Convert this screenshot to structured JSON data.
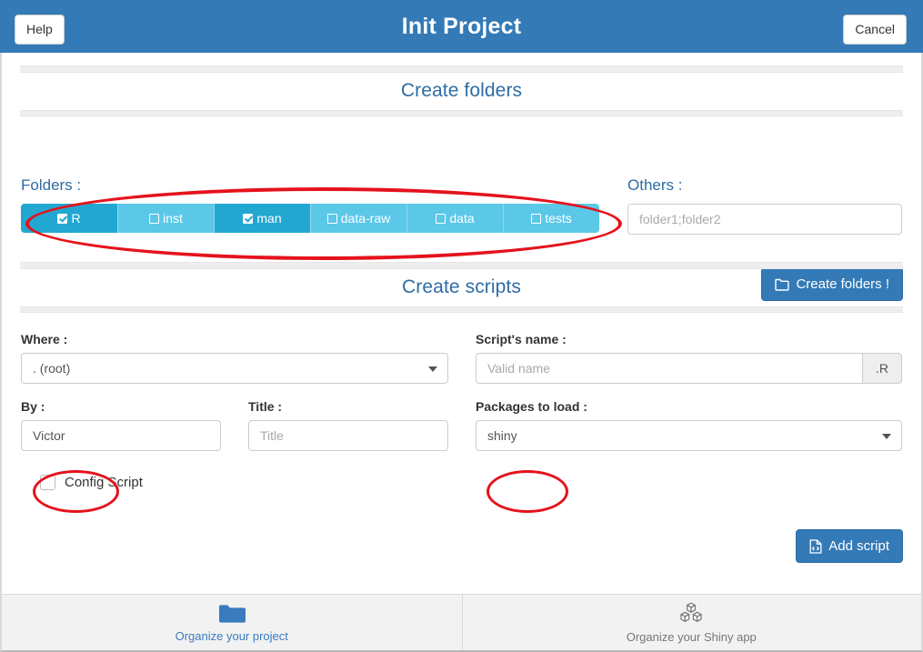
{
  "header": {
    "title": "Init Project",
    "help_label": "Help",
    "cancel_label": "Cancel"
  },
  "sections": {
    "folders": {
      "title": "Create folders",
      "folders_label": "Folders :",
      "others_label": "Others :",
      "others_placeholder": "folder1;folder2",
      "others_value": "",
      "create_button_label": "Create folders !",
      "create_button_icon": "folder-icon",
      "options": [
        {
          "label": "R",
          "checked": true
        },
        {
          "label": "inst",
          "checked": false
        },
        {
          "label": "man",
          "checked": true
        },
        {
          "label": "data-raw",
          "checked": false
        },
        {
          "label": "data",
          "checked": false
        },
        {
          "label": "tests",
          "checked": false
        }
      ]
    },
    "scripts": {
      "title": "Create scripts",
      "where_label": "Where :",
      "where_value": ". (root)",
      "script_name_label": "Script's name :",
      "script_name_placeholder": "Valid name",
      "script_name_value": "",
      "script_name_suffix": ".R",
      "by_label": "By :",
      "by_value": "Victor",
      "title_label": "Title :",
      "title_placeholder": "Title",
      "title_value": "",
      "packages_label": "Packages to load :",
      "packages_value": "shiny",
      "config_script_label": "Config Script",
      "config_script_checked": false,
      "add_button_label": "Add script",
      "add_button_icon": "file-code-icon"
    }
  },
  "footer": {
    "tabs": [
      {
        "label": "Organize your project",
        "icon": "folder-icon",
        "active": true
      },
      {
        "label": "Organize your Shiny app",
        "icon": "cubes-icon",
        "active": false
      }
    ]
  },
  "colors": {
    "header_blue": "#337ab7",
    "section_title_blue": "#2e6ca4",
    "checkbox_active": "#22a7d0",
    "checkbox_inactive": "#5bc8e8",
    "annotation_red": "#e5121c"
  }
}
